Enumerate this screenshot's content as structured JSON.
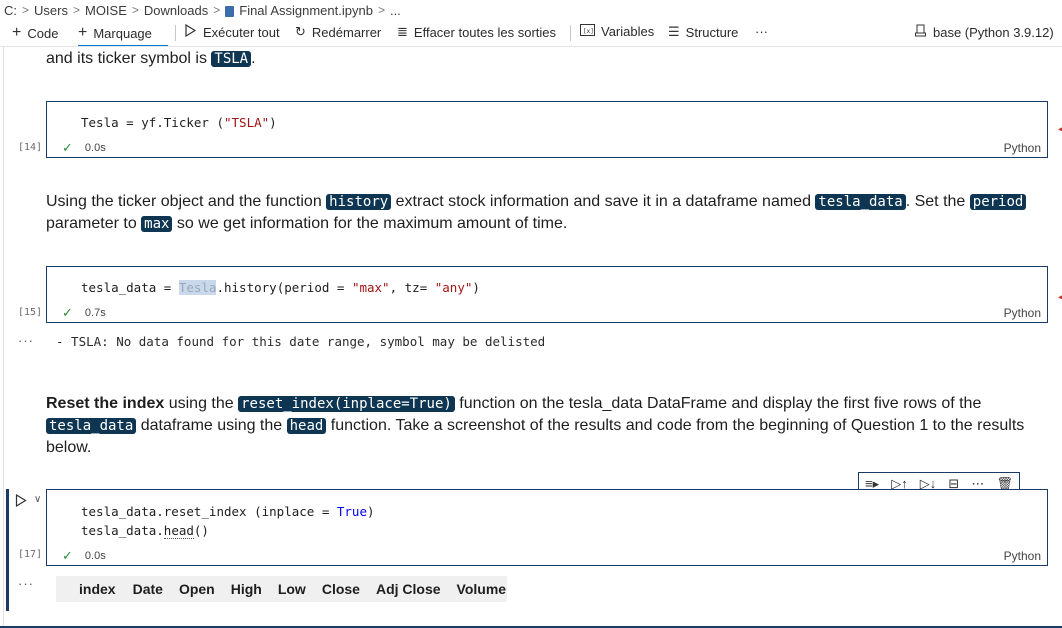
{
  "breadcrumb": {
    "items": [
      "C:",
      "Users",
      "MOISE",
      "Downloads",
      "Final Assignment.ipynb",
      "..."
    ]
  },
  "toolbar": {
    "code_label": "Code",
    "markdown_label": "Marquage",
    "run_all_label": "Exécuter tout",
    "restart_label": "Redémarrer",
    "clear_outputs_label": "Effacer toutes les sorties",
    "variables_label": "Variables",
    "outline_label": "Structure",
    "more_label": "···",
    "kernel_label": "base (Python 3.9.12)"
  },
  "md1": {
    "text": "and its ticker symbol is",
    "tag": "TSLA",
    "end": "."
  },
  "cell14": {
    "exec": "[14]",
    "time": "0.0s",
    "lang": "Python",
    "code": {
      "a": "Tesla = yf.Ticker (",
      "b": "\"TSLA\"",
      "c": ")"
    }
  },
  "md2": {
    "p1": "Using the ticker object and the function",
    "t1": "history",
    "p2": "extract stock information and save it in a dataframe named",
    "t2": "tesla_data",
    "p3": ". Set the",
    "t3": "period",
    "p4": "parameter to",
    "t4": "max",
    "p5": "so we get information for the maximum amount of time."
  },
  "cell15": {
    "exec": "[15]",
    "time": "0.7s",
    "lang": "Python",
    "code": {
      "a": "tesla_data = ",
      "hl": "Tesla",
      "b": ".history(period = ",
      "s1": "\"max\"",
      "c": ", tz= ",
      "s2": "\"any\"",
      "d": ")"
    },
    "output": "- TSLA: No data found for this date range, symbol may be delisted",
    "output_mark": "···"
  },
  "md3": {
    "bold": "Reset the index",
    "p1": "using the",
    "t1": "reset_index(inplace=True)",
    "p2": "function on the tesla_data DataFrame and display the first five rows of the",
    "t2": "tesla_data",
    "p3": "dataframe using the",
    "t3": "head",
    "p4": "function. Take a screenshot of the results and code from the beginning of Question 1 to the",
    "p5": "results below."
  },
  "cell17": {
    "exec": "[17]",
    "time": "0.0s",
    "lang": "Python",
    "line1": {
      "a": "tesla_data.reset_index (inplace = ",
      "kw": "True",
      "b": ")"
    },
    "line2": {
      "a": "tesla_data.",
      "b": "head",
      "c": "()"
    },
    "output_mark": "···",
    "df_columns": [
      "index",
      "Date",
      "Open",
      "High",
      "Low",
      "Close",
      "Adj Close",
      "Volume"
    ]
  }
}
